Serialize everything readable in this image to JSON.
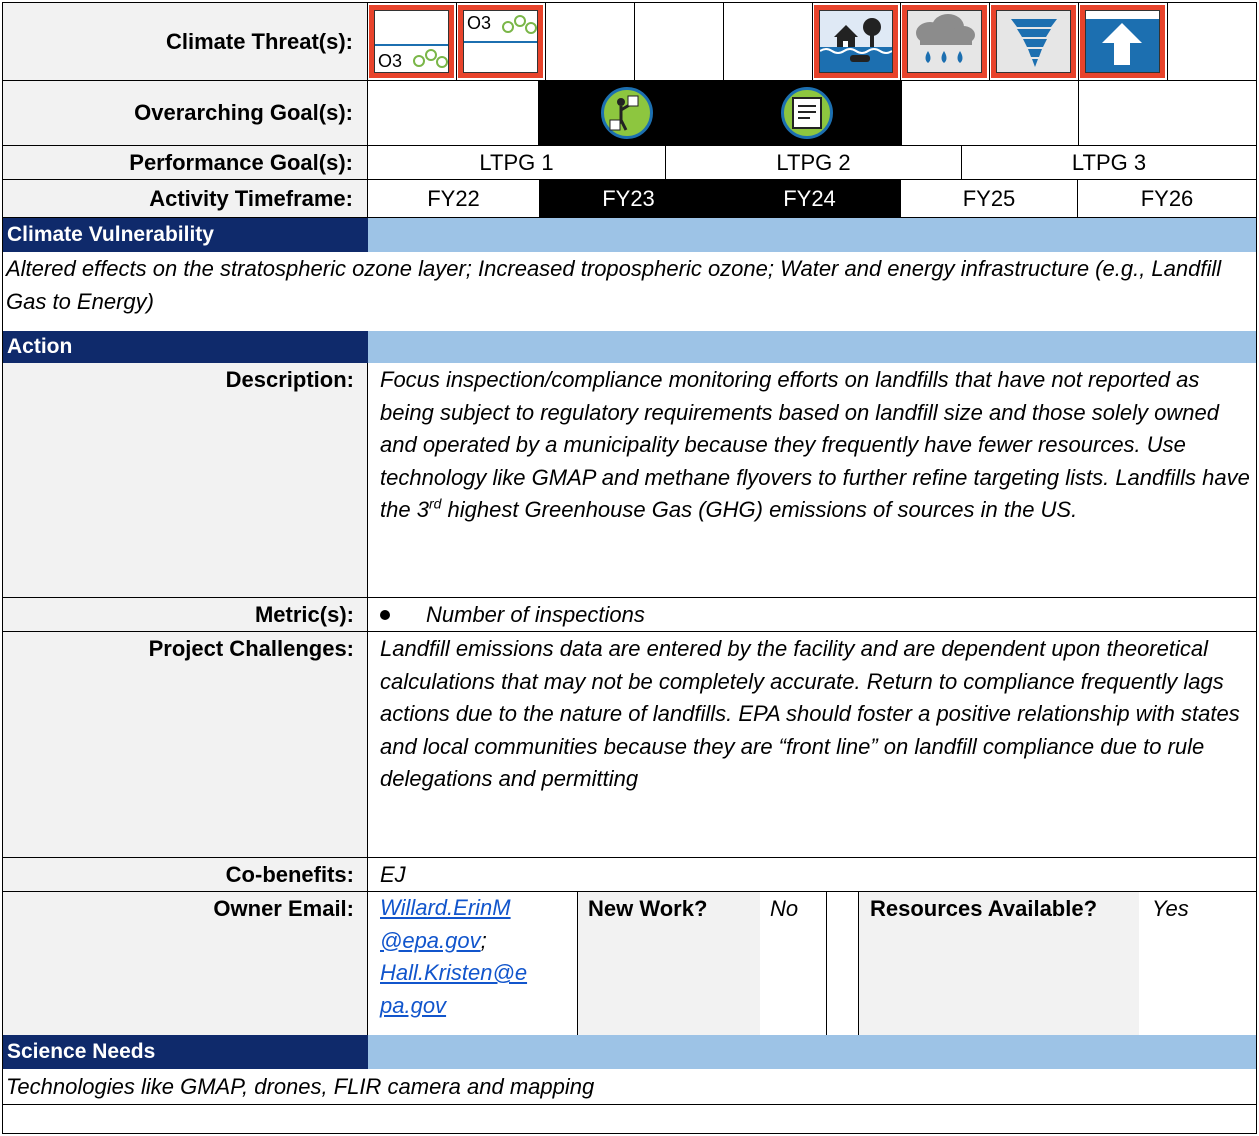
{
  "header": {
    "climate_threats_label": "Climate Threat(s):",
    "overarching_goals_label": "Overarching Goal(s):",
    "performance_goals_label": "Performance Goal(s):",
    "activity_timeframe_label": "Activity Timeframe:"
  },
  "threat_icons": [
    {
      "name": "ozone-stratospheric-icon",
      "text": "O3"
    },
    {
      "name": "ozone-tropospheric-icon",
      "text": "O3"
    },
    {
      "name": "flooding-icon"
    },
    {
      "name": "precipitation-icon"
    },
    {
      "name": "tornado-icon"
    },
    {
      "name": "sea-level-rise-icon"
    }
  ],
  "overarching_goal_icons": [
    "compliance-inspector-icon",
    "regulation-document-icon"
  ],
  "performance_goals": [
    "LTPG 1",
    "LTPG 2",
    "LTPG 3"
  ],
  "timeframe": [
    "FY22",
    "FY23",
    "FY24",
    "FY25",
    "FY26"
  ],
  "selected_years": [
    "FY23",
    "FY24"
  ],
  "climate_vulnerability": {
    "heading": "Climate Vulnerability",
    "text": "Altered effects on the stratospheric ozone layer; Increased tropospheric ozone; Water and energy infrastructure (e.g., Landfill Gas to Energy)"
  },
  "action": {
    "heading": "Action",
    "description_label": "Description:",
    "description_part1": "Focus inspection/compliance monitoring efforts on landfills that have not reported as being subject to regulatory requirements based on landfill size and those solely owned and operated by a municipality because they frequently have fewer resources. Use technology like GMAP and methane flyovers to further refine targeting lists. Landfills have the 3",
    "description_sup": "rd",
    "description_part2": " highest Greenhouse Gas (GHG) emissions of sources in the US.",
    "metrics_label": "Metric(s):",
    "metrics": [
      "Number of inspections"
    ],
    "challenges_label": "Project Challenges:",
    "challenges": "Landfill emissions data are entered by the facility and are dependent upon theoretical calculations that may not be completely accurate. Return to compliance frequently lags actions due to the nature of landfills. EPA should foster a positive relationship with states and local communities because they are “front line” on landfill compliance due to rule delegations and permitting",
    "cobenefits_label": "Co-benefits:",
    "cobenefits": "EJ",
    "owner_label": "Owner Email:",
    "owner_email_1a": "Willard.ErinM",
    "owner_email_1b": "@epa.gov",
    "owner_sep": ";",
    "owner_email_2a": "Hall.Kristen@e",
    "owner_email_2b": "pa.gov",
    "new_work_label": "New Work?",
    "new_work_value": "No",
    "resources_label": "Resources Available?",
    "resources_value": "Yes"
  },
  "science_needs": {
    "heading": "Science Needs",
    "text": "Technologies like GMAP, drones, FLIR camera and mapping"
  }
}
